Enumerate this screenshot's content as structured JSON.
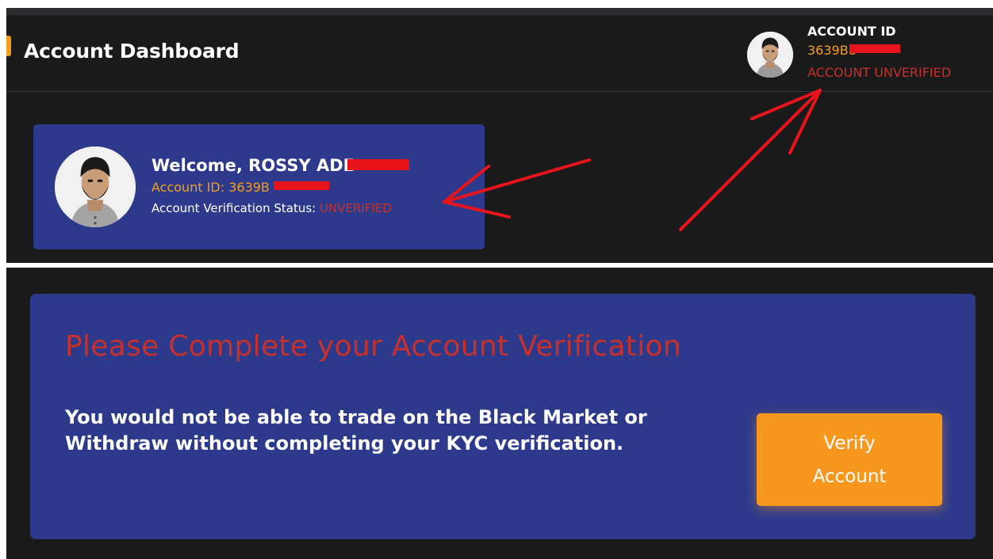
{
  "header": {
    "title": "Account Dashboard",
    "account_label": "ACCOUNT ID",
    "account_id": "3639B8",
    "account_status": "ACCOUNT UNVERIFIED"
  },
  "welcome_card": {
    "greeting": "Welcome, ROSSY ADE",
    "account_id_line": "Account ID: 3639B",
    "status_label": "Account Verification Status: ",
    "status_value": "UNVERIFIED"
  },
  "kyc_notice": {
    "heading": "Please Complete your Account Verification",
    "body": "You would not be able to trade on the Black Market or Withdraw without completing your KYC verification.",
    "button_label": "Verify Account"
  },
  "colors": {
    "background": "#1a1a1a",
    "card": "#2d3a8c",
    "accent_orange": "#f59d1f",
    "alert_red": "#c8302a",
    "redaction_red": "#e8141b"
  },
  "icons": [
    "user-avatar-icon",
    "annotation-arrow-icon"
  ]
}
